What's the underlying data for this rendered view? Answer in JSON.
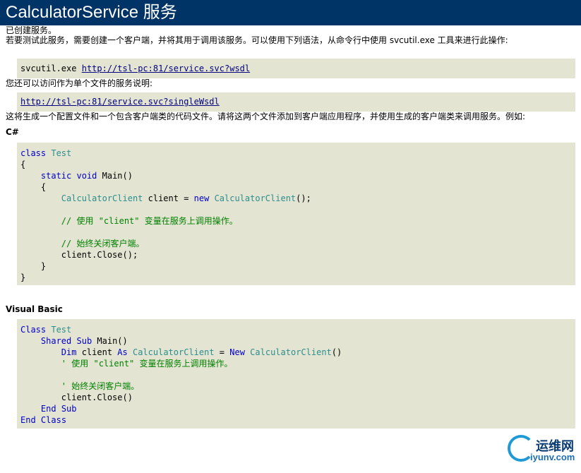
{
  "page": {
    "title": "CalculatorService 服务",
    "created": "已创建服务。",
    "intro": "若要测试此服务，需要创建一个客户端，并将其用于调用该服务。可以使用下列语法，从命令行中使用 svcutil.exe 工具来进行此操作:",
    "svcutil_cmd": "svcutil.exe",
    "wsdl_link": "http://tsl-pc:81/service.svc?wsdl",
    "single_wsdl_intro": "您还可以访问作为单个文件的服务说明:",
    "single_wsdl_link": "http://tsl-pc:81/service.svc?singleWsdl",
    "generate_info": "这将生成一个配置文件和一个包含客户端类的代码文件。请将这两个文件添加到客户端应用程序，并使用生成的客户端类来调用服务。例如:"
  },
  "csharp": {
    "label": "C#",
    "lines": [
      [
        {
          "t": "class",
          "c": "kw"
        },
        {
          "t": " "
        },
        {
          "t": "Test",
          "c": "ty"
        }
      ],
      [
        {
          "t": "{"
        }
      ],
      [
        {
          "t": "    "
        },
        {
          "t": "static",
          "c": "kw"
        },
        {
          "t": " "
        },
        {
          "t": "void",
          "c": "kw"
        },
        {
          "t": " Main()"
        }
      ],
      [
        {
          "t": "    {"
        }
      ],
      [
        {
          "t": "        "
        },
        {
          "t": "CalculatorClient",
          "c": "ty"
        },
        {
          "t": " client = "
        },
        {
          "t": "new",
          "c": "kw"
        },
        {
          "t": " "
        },
        {
          "t": "CalculatorClient",
          "c": "ty"
        },
        {
          "t": "();"
        }
      ],
      [
        {
          "t": ""
        }
      ],
      [
        {
          "t": "        "
        },
        {
          "t": "// 使用 \"client\" 变量在服务上调用操作。",
          "c": "cm"
        }
      ],
      [
        {
          "t": ""
        }
      ],
      [
        {
          "t": "        "
        },
        {
          "t": "// 始终关闭客户端。",
          "c": "cm"
        }
      ],
      [
        {
          "t": "        client.Close();"
        }
      ],
      [
        {
          "t": "    }"
        }
      ],
      [
        {
          "t": "}"
        }
      ]
    ]
  },
  "vb": {
    "label": "Visual Basic",
    "lines": [
      [
        {
          "t": "Class",
          "c": "kw"
        },
        {
          "t": " "
        },
        {
          "t": "Test",
          "c": "ty"
        }
      ],
      [
        {
          "t": "    "
        },
        {
          "t": "Shared",
          "c": "kw"
        },
        {
          "t": " "
        },
        {
          "t": "Sub",
          "c": "kw"
        },
        {
          "t": " Main()"
        }
      ],
      [
        {
          "t": "        "
        },
        {
          "t": "Dim",
          "c": "kw"
        },
        {
          "t": " client "
        },
        {
          "t": "As",
          "c": "kw"
        },
        {
          "t": " "
        },
        {
          "t": "CalculatorClient",
          "c": "ty"
        },
        {
          "t": " = "
        },
        {
          "t": "New",
          "c": "kw"
        },
        {
          "t": " "
        },
        {
          "t": "CalculatorClient",
          "c": "ty"
        },
        {
          "t": "()"
        }
      ],
      [
        {
          "t": "        "
        },
        {
          "t": "' 使用 \"client\" 变量在服务上调用操作。",
          "c": "cm"
        }
      ],
      [
        {
          "t": ""
        }
      ],
      [
        {
          "t": "        "
        },
        {
          "t": "' 始终关闭客户端。",
          "c": "cm"
        }
      ],
      [
        {
          "t": "        client.Close()"
        }
      ],
      [
        {
          "t": "    "
        },
        {
          "t": "End",
          "c": "kw"
        },
        {
          "t": " "
        },
        {
          "t": "Sub",
          "c": "kw"
        }
      ],
      [
        {
          "t": "End",
          "c": "kw"
        },
        {
          "t": " "
        },
        {
          "t": "Class",
          "c": "kw"
        }
      ]
    ]
  },
  "watermark": {
    "title": "运维网",
    "url": "iyunv.com"
  }
}
